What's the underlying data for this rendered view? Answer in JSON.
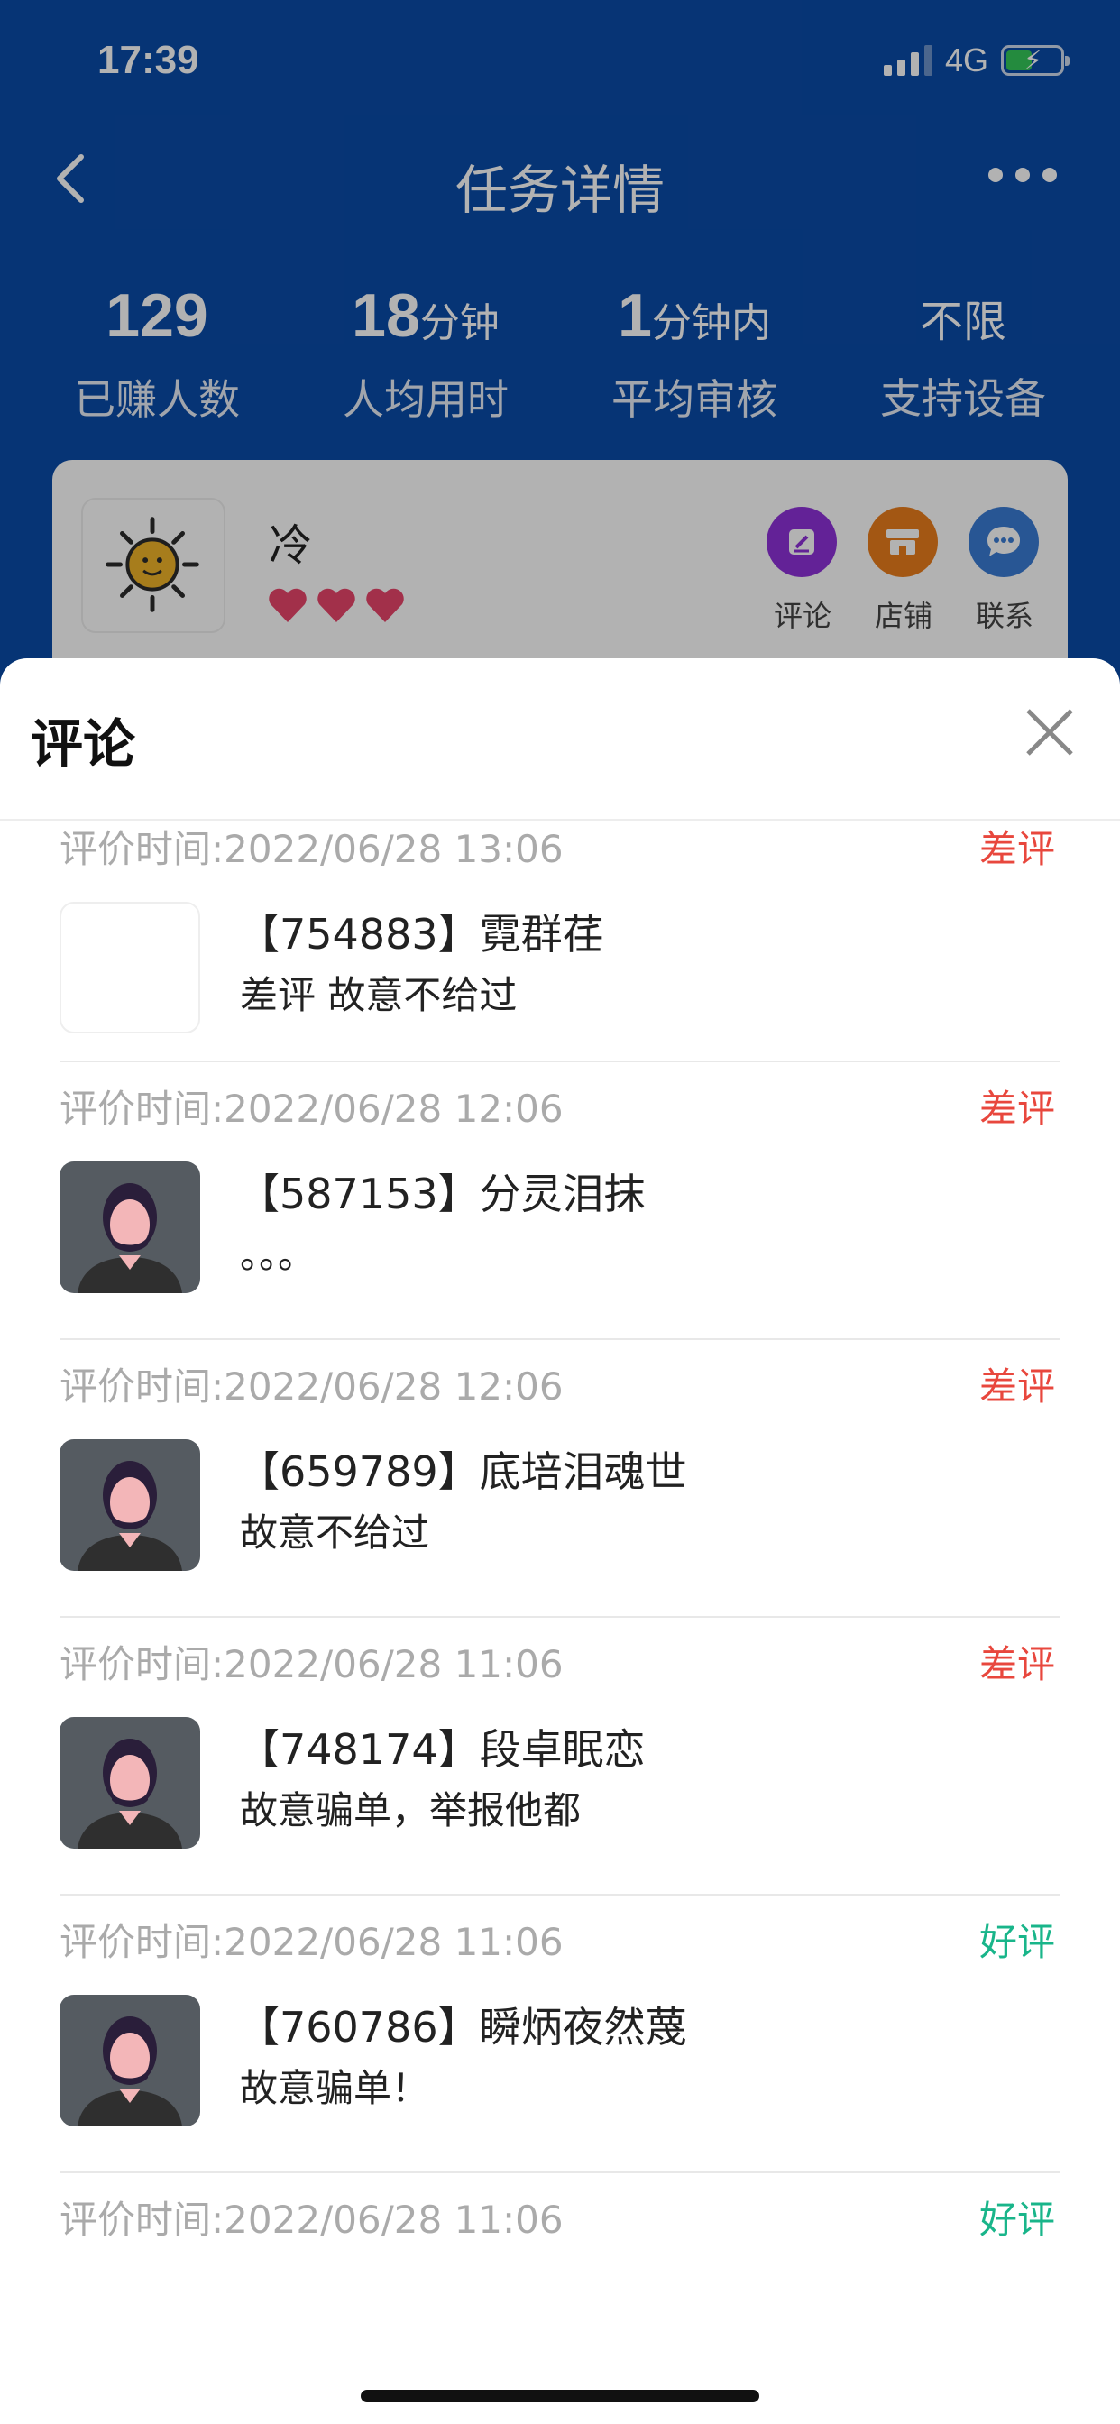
{
  "status_bar": {
    "time": "17:39",
    "network": "4G"
  },
  "nav": {
    "title": "任务详情"
  },
  "stats": [
    {
      "value": "129",
      "unit": "",
      "label": "已赚人数"
    },
    {
      "value": "18",
      "unit": "分钟",
      "label": "人均用时"
    },
    {
      "value": "1",
      "unit": "分钟内",
      "label": "平均审核"
    },
    {
      "value": "",
      "unit": "不限",
      "label": "支持设备"
    }
  ],
  "shop": {
    "name": "冷",
    "hearts": 3,
    "actions": [
      {
        "label": "评论",
        "icon": "edit-icon",
        "color": "#8a2be2"
      },
      {
        "label": "店铺",
        "icon": "store-icon",
        "color": "#e67e22"
      },
      {
        "label": "联系",
        "icon": "chat-icon",
        "color": "#3a7bd5"
      }
    ]
  },
  "sheet": {
    "title": "评论",
    "comments": [
      {
        "time": "评价时间:2022/06/28 13:06",
        "rating": "差评",
        "user": "【754883】霓群荏",
        "message": "差评 故意不给过",
        "avatar": "blank"
      },
      {
        "time": "评价时间:2022/06/28 12:06",
        "rating": "差评",
        "user": "【587153】分灵泪抹",
        "message": "。。。",
        "avatar": "person"
      },
      {
        "time": "评价时间:2022/06/28 12:06",
        "rating": "差评",
        "user": "【659789】底培泪魂世",
        "message": "故意不给过",
        "avatar": "person"
      },
      {
        "time": "评价时间:2022/06/28 11:06",
        "rating": "差评",
        "user": "【748174】段卓眠恋",
        "message": "故意骗单，举报他都",
        "avatar": "person"
      },
      {
        "time": "评价时间:2022/06/28 11:06",
        "rating": "好评",
        "user": "【760786】瞬炳夜然蔑",
        "message": "故意骗单！",
        "avatar": "person"
      },
      {
        "time": "评价时间:2022/06/28 11:06",
        "rating": "好评",
        "user": "",
        "message": "",
        "avatar": "none"
      }
    ]
  },
  "colors": {
    "primary": "#0a4ba8",
    "bad": "#e8473d",
    "good": "#19b58a"
  }
}
